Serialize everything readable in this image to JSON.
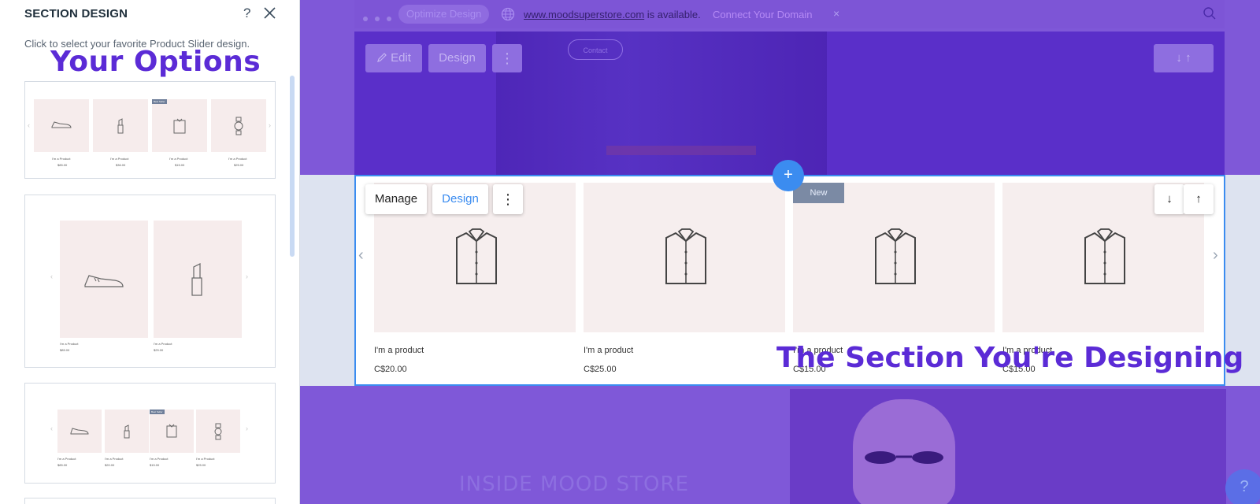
{
  "panel": {
    "title": "SECTION DESIGN",
    "help_label": "?",
    "subtitle": "Click to select your favorite Product Slider design.",
    "overlay_label": "Your Options"
  },
  "cards": [
    {
      "name": "slider-4-up",
      "product_name": "I'm a Product",
      "prices": [
        "$85.00",
        "$36.00",
        "$15.00",
        "$25.00"
      ],
      "badge": "Best Seller"
    },
    {
      "name": "slider-2-up",
      "product_name": "I'm a Product",
      "prices": [
        "$85.00",
        "$25.00"
      ]
    },
    {
      "name": "slider-4-up-compact",
      "product_name": "I'm a Product",
      "prices": [
        "$85.00",
        "$20.00",
        "$15.00",
        "$25.00"
      ],
      "badge": "Best Seller"
    }
  ],
  "topbar": {
    "optimize_label": "Optimize Design",
    "domain": "www.moodsuperstore.com",
    "available_text": " is available.",
    "connect_label": "Connect Your Domain",
    "dismiss": "×"
  },
  "upper_toolbar": {
    "edit_label": "Edit",
    "design_label": "Design",
    "more_label": "⋮",
    "arrows_label": "↓   ↑",
    "contact_label": "Contact"
  },
  "section_toolbar": {
    "manage_label": "Manage",
    "design_label": "Design",
    "more_label": "⋮",
    "down_label": "↓",
    "up_label": "↑",
    "add_label": "+"
  },
  "products": [
    {
      "name": "I'm a product",
      "price": "C$20.00"
    },
    {
      "name": "I'm a product",
      "price": "C$25.00"
    },
    {
      "name": "I'm a product",
      "price": "C$15.00",
      "badge": "New"
    },
    {
      "name": "I'm a product",
      "price": "C$15.00"
    }
  ],
  "slider": {
    "prev": "‹",
    "next": "›"
  },
  "overlay_section_label": "The Section You're Designing",
  "lower": {
    "inside_text": "INSIDE MOOD STORE"
  },
  "help_bubble": "?",
  "colors": {
    "accent": "#3b8cf0",
    "overlay": "#7f58d8",
    "annotation": "#5b2bd6",
    "tile": "#f6eeee"
  }
}
